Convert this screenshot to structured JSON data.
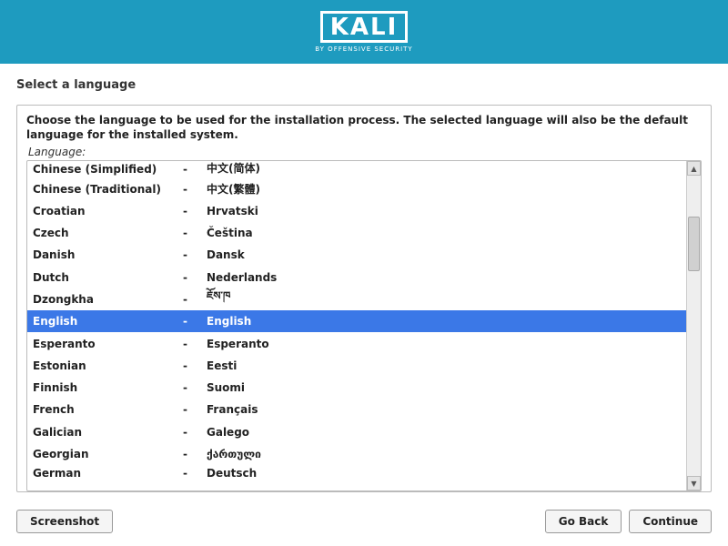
{
  "logo": {
    "title": "KALI",
    "subtitle": "BY OFFENSIVE SECURITY"
  },
  "page_title": "Select a language",
  "instruction": "Choose the language to be used for the installation process. The selected language will also be the default language for the installed system.",
  "language_label": "Language:",
  "languages": [
    {
      "en": "Chinese (Simplified)",
      "sep": "-",
      "native": "中文(简体)"
    },
    {
      "en": "Chinese (Traditional)",
      "sep": "-",
      "native": "中文(繁體)"
    },
    {
      "en": "Croatian",
      "sep": "-",
      "native": "Hrvatski"
    },
    {
      "en": "Czech",
      "sep": "-",
      "native": "Čeština"
    },
    {
      "en": "Danish",
      "sep": "-",
      "native": "Dansk"
    },
    {
      "en": "Dutch",
      "sep": "-",
      "native": "Nederlands"
    },
    {
      "en": "Dzongkha",
      "sep": "-",
      "native": "ཇོས་ཁ"
    },
    {
      "en": "English",
      "sep": "-",
      "native": "English",
      "selected": true
    },
    {
      "en": "Esperanto",
      "sep": "-",
      "native": "Esperanto"
    },
    {
      "en": "Estonian",
      "sep": "-",
      "native": "Eesti"
    },
    {
      "en": "Finnish",
      "sep": "-",
      "native": "Suomi"
    },
    {
      "en": "French",
      "sep": "-",
      "native": "Français"
    },
    {
      "en": "Galician",
      "sep": "-",
      "native": "Galego"
    },
    {
      "en": "Georgian",
      "sep": "-",
      "native": "ქართული"
    },
    {
      "en": "German",
      "sep": "-",
      "native": "Deutsch"
    }
  ],
  "buttons": {
    "screenshot": "Screenshot",
    "go_back": "Go Back",
    "continue": "Continue"
  }
}
